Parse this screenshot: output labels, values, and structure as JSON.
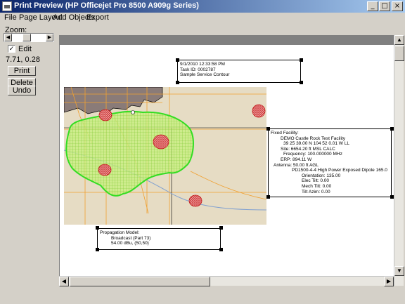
{
  "window": {
    "title": "Print Preview (HP Officejet Pro 8500 A909g Series)",
    "minimize_glyph": "_",
    "maximize_glyph": "□",
    "close_glyph": "×"
  },
  "menu": {
    "items": [
      {
        "label": "File"
      },
      {
        "label": "Page Layout"
      },
      {
        "label": "Add Objects"
      },
      {
        "label": "Export"
      }
    ]
  },
  "left_panel": {
    "zoom_label": "Zoom:",
    "edit_label": "Edit",
    "edit_checked": true,
    "check_glyph": "✓",
    "coordinates": "7.71, 0.28",
    "print_button": "Print",
    "delete_button": "Delete",
    "undo_button": "Undo"
  },
  "header_box": {
    "lines": [
      "9/1/2010 12:33:58 PM",
      "Task ID: 0002787",
      "Sample Service Contour"
    ]
  },
  "facility_box": {
    "lines": [
      "Fixed Facility:",
      "DEMO Castle Rock Test Facility",
      "39 25 39.00 N 104 52 0.01 W LL",
      "Site: 6654.20 ft MSL CALC",
      "Frequency: 100.000000 MHz",
      "ERP: 894.11 W",
      "Antenna: 50.00 ft AGL",
      "PD1500-4-4 High Power Exposed Dipole 165.0",
      "Orientation: 135.00",
      "Elec Tilt: 0.00",
      "Mech Tilt: 0.00",
      "Tilt Azim: 0.00"
    ]
  },
  "propagation_box": {
    "lines": [
      "Propagation Model:",
      "Broadcast (Part 73)",
      "54.00 dBu, (50,50)"
    ]
  },
  "colors": {
    "contour": "#33dd22",
    "fill": "#c8f080",
    "hatch": "#e84040",
    "urban": "#8a7b78",
    "roads": "#f0a030"
  }
}
